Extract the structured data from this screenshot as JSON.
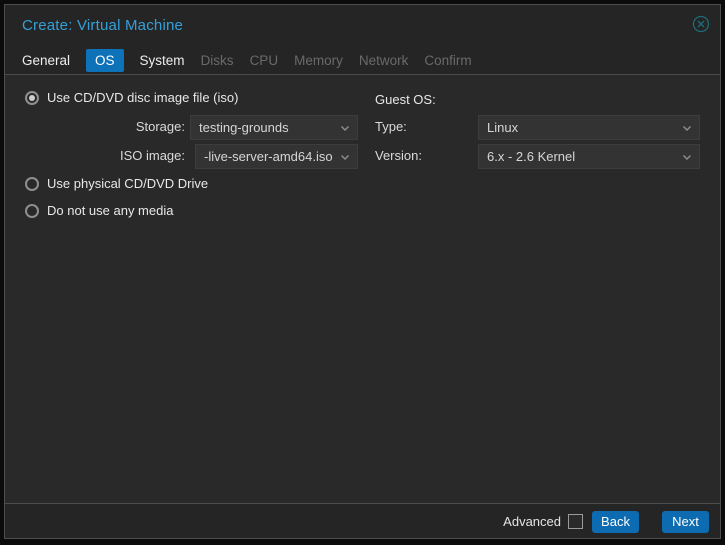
{
  "window": {
    "title": "Create: Virtual Machine",
    "close_icon": "circle-x-icon"
  },
  "tabs": [
    {
      "label": "General",
      "state": "enabled"
    },
    {
      "label": "OS",
      "state": "active"
    },
    {
      "label": "System",
      "state": "enabled"
    },
    {
      "label": "Disks",
      "state": "disabled"
    },
    {
      "label": "CPU",
      "state": "disabled"
    },
    {
      "label": "Memory",
      "state": "disabled"
    },
    {
      "label": "Network",
      "state": "disabled"
    },
    {
      "label": "Confirm",
      "state": "disabled"
    }
  ],
  "media_section": {
    "radio_iso": {
      "label": "Use CD/DVD disc image file (iso)",
      "selected": true
    },
    "storage": {
      "label": "Storage:",
      "value": "testing-grounds"
    },
    "iso_image": {
      "label": "ISO image:",
      "value": "-live-server-amd64.iso"
    },
    "radio_physical": {
      "label": "Use physical CD/DVD Drive",
      "selected": false
    },
    "radio_no_media": {
      "label": "Do not use any media",
      "selected": false
    }
  },
  "guest_os_section": {
    "heading": "Guest OS:",
    "type": {
      "label": "Type:",
      "value": "Linux"
    },
    "version": {
      "label": "Version:",
      "value": "6.x - 2.6 Kernel"
    }
  },
  "footer": {
    "advanced_label": "Advanced",
    "advanced_checked": false,
    "back_label": "Back",
    "next_label": "Next"
  },
  "colors": {
    "accent_blue": "#0e72b8",
    "title_blue": "#35a0d8",
    "dialog_bg": "#252525",
    "content_bg": "#292929",
    "dropdown_bg": "#333333",
    "disabled_text": "#6a6a6a"
  }
}
